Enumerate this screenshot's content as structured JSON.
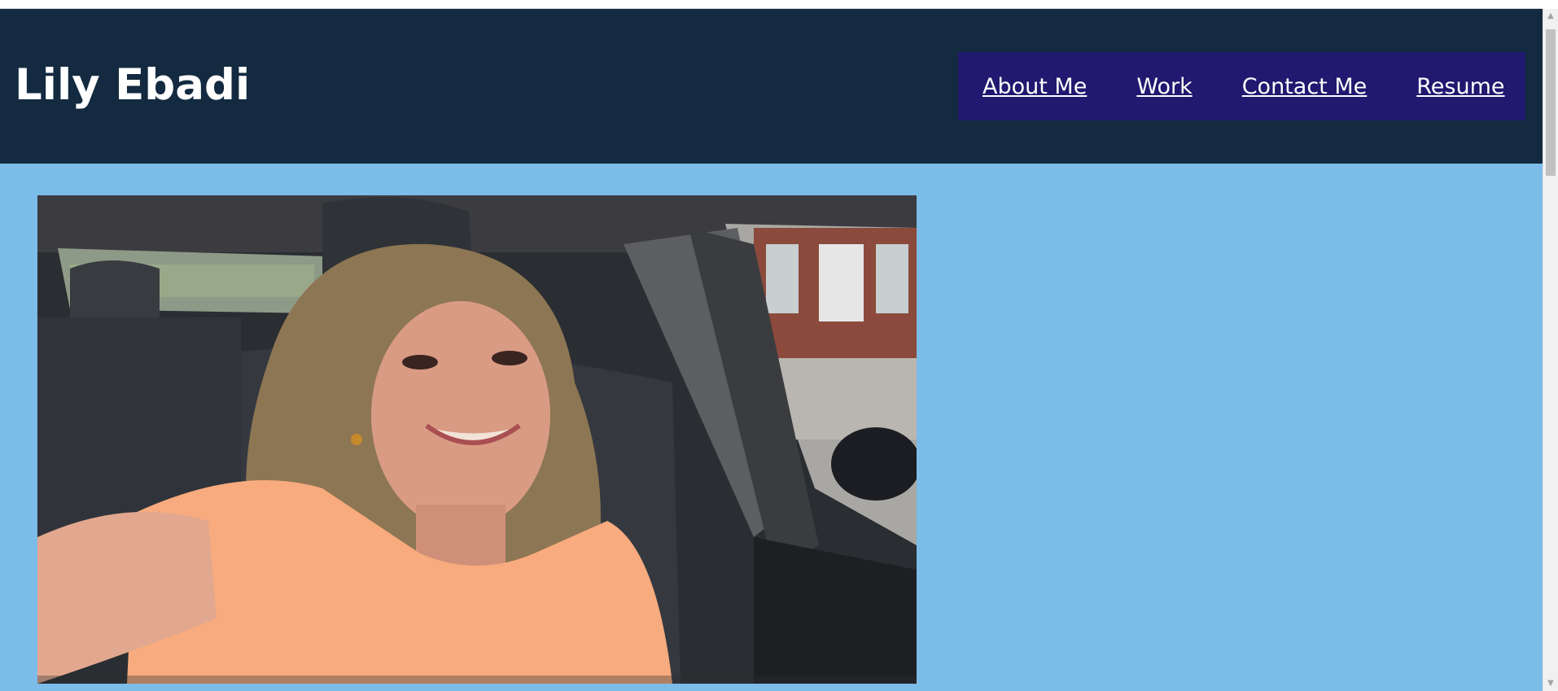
{
  "site": {
    "title": "Lily Ebadi"
  },
  "nav": {
    "items": [
      {
        "label": "About Me"
      },
      {
        "label": "Work"
      },
      {
        "label": "Contact Me"
      },
      {
        "label": "Resume"
      }
    ]
  },
  "portrait": {
    "alt": "selfie-photo"
  },
  "colors": {
    "header_bg": "#132a40",
    "nav_bg": "#21186f",
    "page_bg": "#7bbce8",
    "title_text": "#ffffff"
  },
  "icons": {
    "scroll_up": "triangle-up-icon",
    "scroll_down": "triangle-down-icon"
  }
}
